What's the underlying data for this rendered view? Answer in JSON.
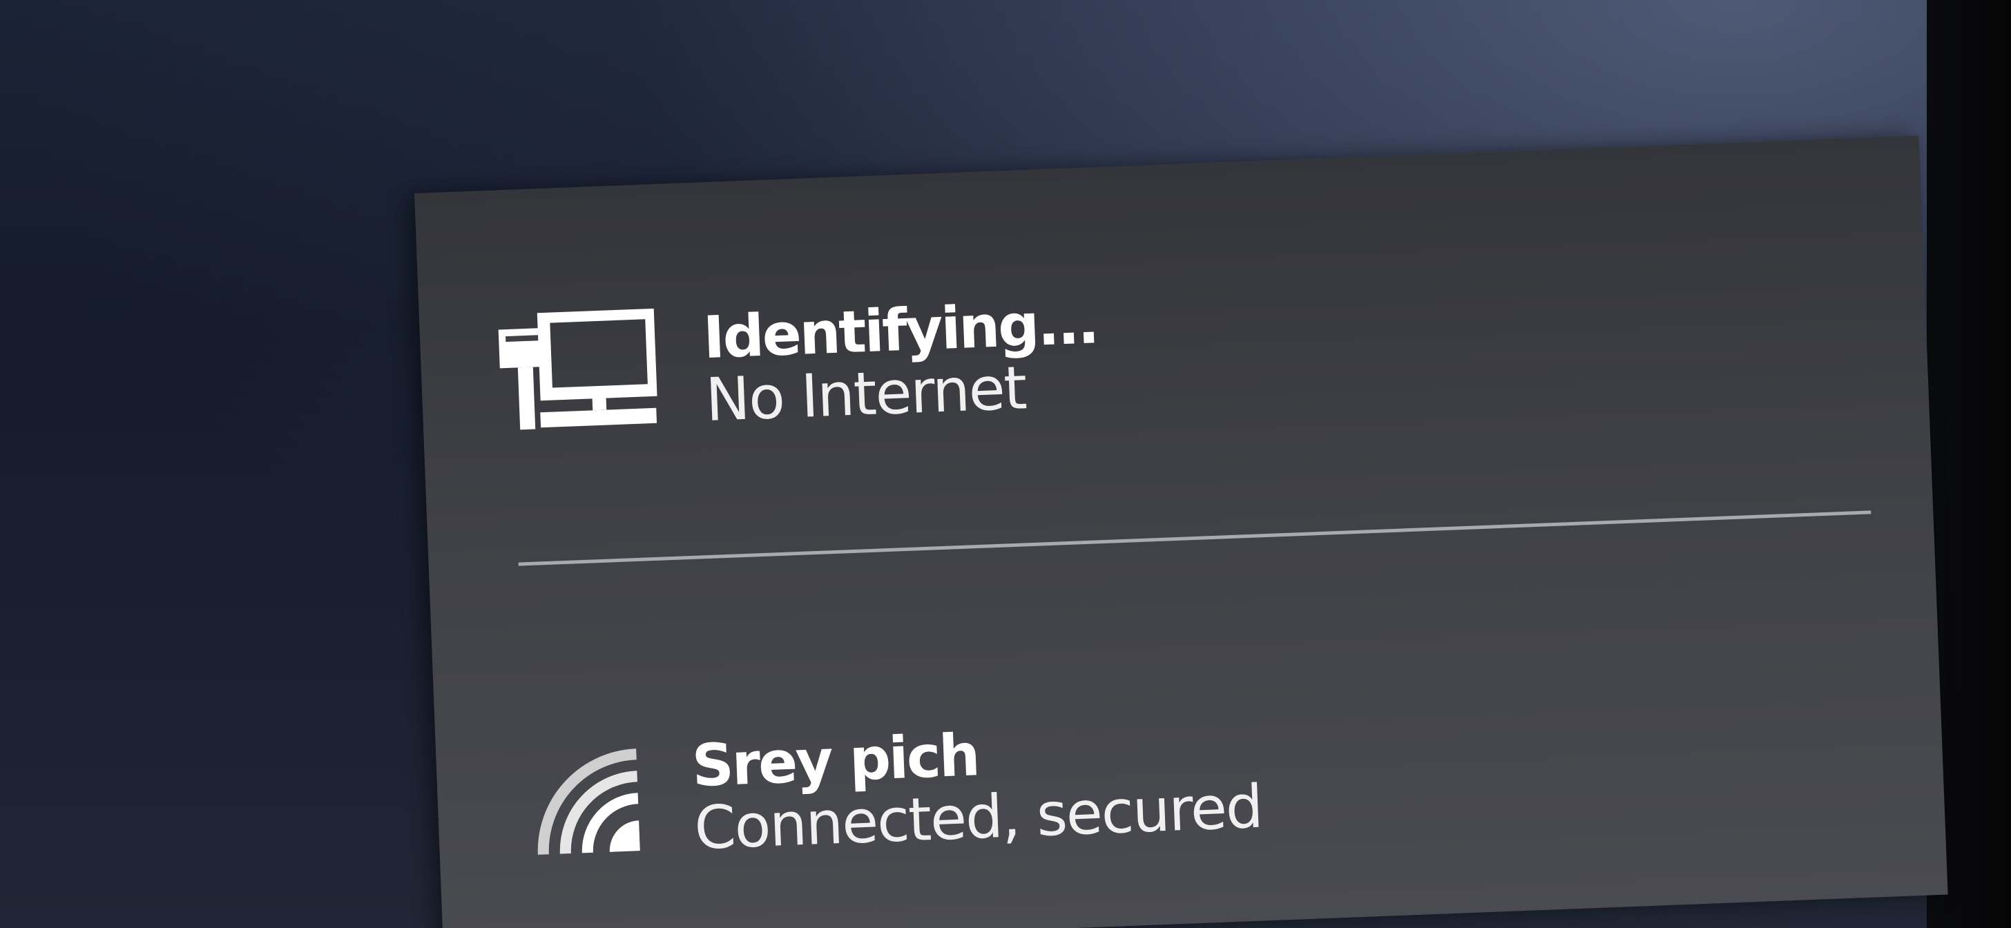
{
  "flyout": {
    "networks": [
      {
        "name": "Identifying...",
        "status": "No Internet",
        "icon": "ethernet-monitor-icon"
      },
      {
        "name": "Srey pich",
        "status": "Connected, secured",
        "icon": "wifi-signal-icon"
      }
    ]
  },
  "colors": {
    "panel_bg": "#404146",
    "text": "#ffffff",
    "divider": "#a9aaae",
    "desktop_bg": "#1b2336"
  }
}
